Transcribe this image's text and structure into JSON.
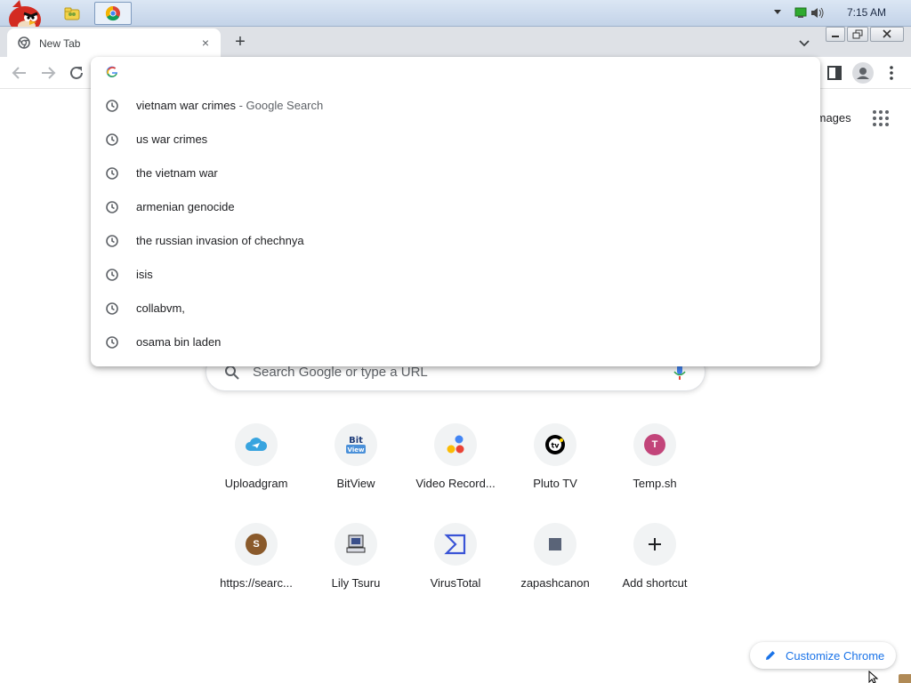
{
  "taskbar": {
    "clock": "7:15 AM",
    "icons": [
      "angry-bird-icon",
      "folder-icon",
      "chrome-icon"
    ],
    "tray_icons": [
      "chevron-down-icon",
      "network-icon",
      "speaker-icon"
    ]
  },
  "browser": {
    "tab": {
      "title": "New Tab",
      "close_glyph": "×"
    },
    "new_tab_glyph": "+",
    "window_controls": [
      "minimize",
      "restore",
      "close"
    ]
  },
  "omnibox": {
    "input_value": "",
    "suggestions": [
      {
        "text": "vietnam war crimes",
        "desc": " - Google Search"
      },
      {
        "text": "us war crimes",
        "desc": ""
      },
      {
        "text": "the vietnam war",
        "desc": ""
      },
      {
        "text": "armenian genocide",
        "desc": ""
      },
      {
        "text": "the russian invasion of chechnya",
        "desc": ""
      },
      {
        "text": "isis",
        "desc": ""
      },
      {
        "text": "collabvm,",
        "desc": ""
      },
      {
        "text": "osama bin laden",
        "desc": ""
      }
    ]
  },
  "page": {
    "images_link": "Images",
    "search_placeholder": "Search Google or type a URL",
    "shortcuts": [
      {
        "label": "Uploadgram",
        "icon": "cloud-upload-icon"
      },
      {
        "label": "BitView",
        "icon": "bitview-icon"
      },
      {
        "label": "Video Record...",
        "icon": "video-record-icon"
      },
      {
        "label": "Pluto TV",
        "icon": "pluto-tv-icon"
      },
      {
        "label": "Temp.sh",
        "icon": "letter-t-icon",
        "letter": "T",
        "color": "#c2457a"
      },
      {
        "label": "https://searc...",
        "icon": "letter-s-icon",
        "letter": "S",
        "color": "#8a5a2b"
      },
      {
        "label": "Lily Tsuru",
        "icon": "computer-icon"
      },
      {
        "label": "VirusTotal",
        "icon": "virustotal-icon"
      },
      {
        "label": "zapashcanon",
        "icon": "square-icon"
      },
      {
        "label": "Add shortcut",
        "icon": "plus-icon"
      }
    ],
    "customize_label": "Customize Chrome"
  },
  "colors": {
    "accent": "#1a73e8",
    "tabstrip": "#dee1e6"
  }
}
